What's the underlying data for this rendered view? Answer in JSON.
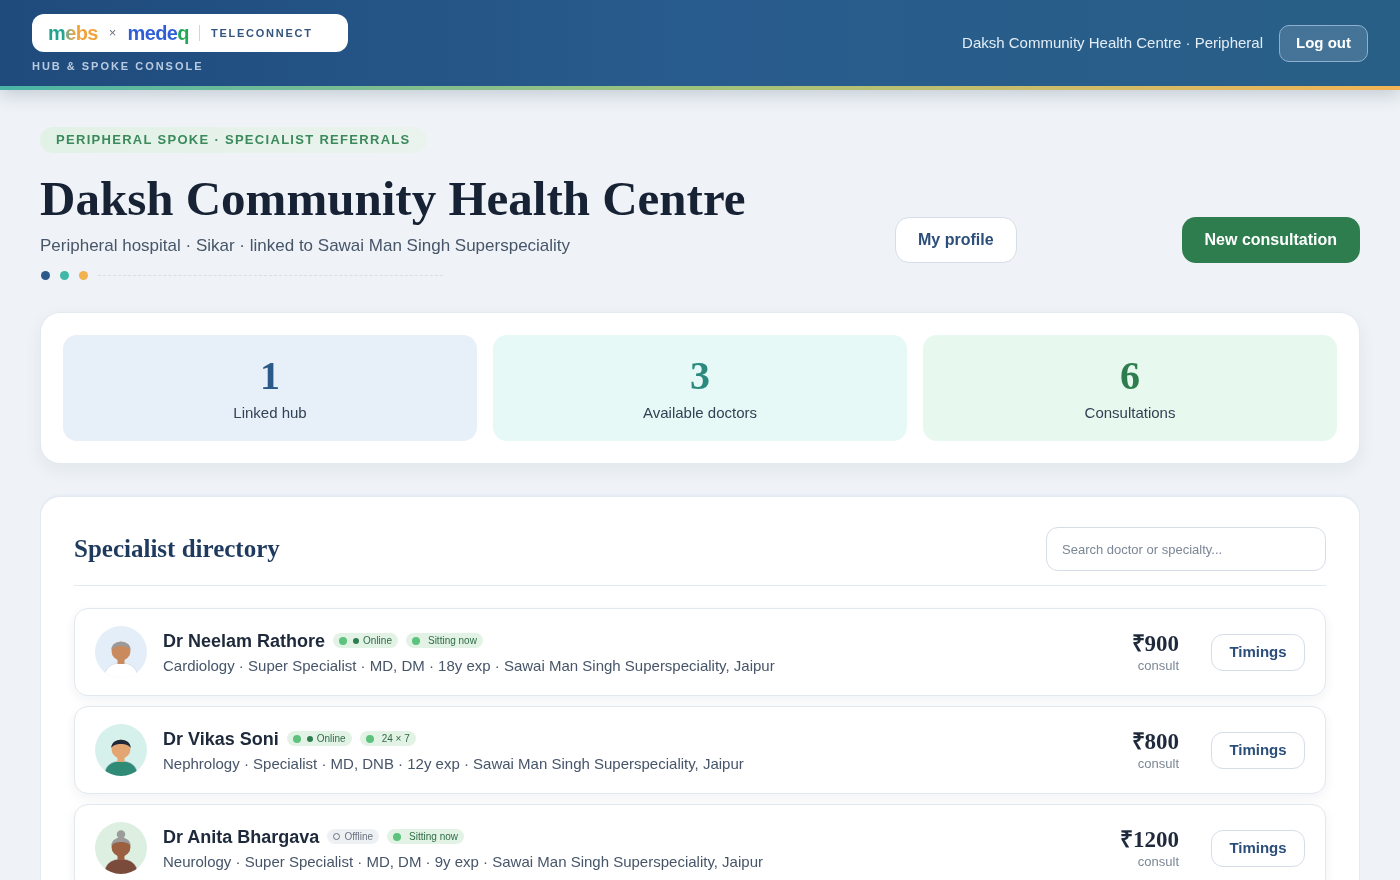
{
  "header": {
    "logo": {
      "brand_1": "mebs",
      "separator": "×",
      "brand_2": "medeq",
      "product": "TELECONNECT"
    },
    "console_label": "HUB & SPOKE CONSOLE",
    "facility": "Daksh Community Health Centre · Peripheral",
    "logout_button": "Log out"
  },
  "hero": {
    "eyebrow": "PERIPHERAL SPOKE · SPECIALIST REFERRALS",
    "title": "Daksh Community Health Centre",
    "subtitle": "Peripheral hospital · Sikar · linked to Sawai Man Singh Superspeciality",
    "dots": [
      {
        "color": "#2b5a8a"
      },
      {
        "color": "#3fb8a8"
      },
      {
        "color": "#f2b24e"
      }
    ],
    "actions": [
      {
        "label": "My profile",
        "kind": "secondary"
      },
      {
        "label": "New consultation",
        "kind": "primary"
      }
    ]
  },
  "stats": [
    {
      "value": "1",
      "label": "Linked hub",
      "color": "#2b5a8a"
    },
    {
      "value": "3",
      "label": "Available doctors",
      "color": "#2b8a7e"
    },
    {
      "value": "6",
      "label": "Consultations",
      "color": "#2e7d4f"
    }
  ],
  "directory": {
    "title": "Specialist directory",
    "search": {
      "placeholder": "Search doctor or specialty..."
    },
    "doctors": [
      {
        "name": "Dr Neelam Rathore",
        "avatar": {
          "kind": "grey-short"
        },
        "online": true,
        "status_label": "Online",
        "availability": "Sitting now",
        "details": "Cardiology · Super Specialist · MD, DM · 18y exp · Sawai Man Singh Superspeciality, Jaipur",
        "fee": "₹900",
        "fee_label": "consult",
        "button": "Timings"
      },
      {
        "name": "Dr Vikas Soni",
        "avatar": {
          "kind": "dark-short"
        },
        "online": true,
        "status_label": "Online",
        "availability": "24 × 7",
        "details": "Nephrology · Specialist · MD, DNB · 12y exp · Sawai Man Singh Superspeciality, Jaipur",
        "fee": "₹800",
        "fee_label": "consult",
        "button": "Timings"
      },
      {
        "name": "Dr Anita Bhargava",
        "avatar": {
          "kind": "grey-bun"
        },
        "online": false,
        "status_label": "Offline",
        "availability": "Sitting now",
        "details": "Neurology · Super Specialist · MD, DM · 9y exp · Sawai Man Singh Superspeciality, Jaipur",
        "fee": "₹1200",
        "fee_label": "consult",
        "button": "Timings"
      }
    ]
  }
}
